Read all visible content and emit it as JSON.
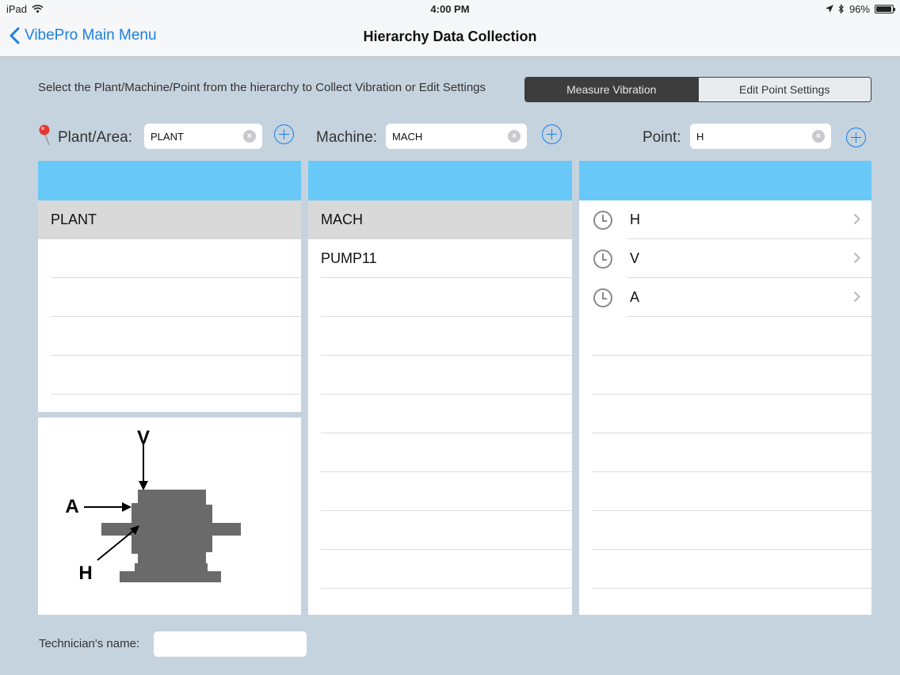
{
  "status": {
    "device": "iPad",
    "time": "4:00 PM",
    "battery": "96%",
    "battery_level": 0.96
  },
  "nav": {
    "back_label": "VibePro Main Menu",
    "title": "Hierarchy Data Collection"
  },
  "instruction": "Select the Plant/Machine/Point from the hierarchy to Collect Vibration or Edit Settings",
  "segments": {
    "measure": "Measure Vibration",
    "edit": "Edit Point Settings"
  },
  "plant": {
    "label": "Plant/Area:",
    "search_value": "PLANT",
    "items": [
      "PLANT"
    ]
  },
  "machine": {
    "label": "Machine:",
    "search_value": "MACH",
    "items": [
      "MACH",
      "PUMP11"
    ]
  },
  "point": {
    "label": "Point:",
    "search_value": "H",
    "items": [
      "H",
      "V",
      "A"
    ]
  },
  "diagram": {
    "v": "V",
    "a": "A",
    "h": "H"
  },
  "technician": {
    "label": "Technician's name:",
    "value": ""
  },
  "colors": {
    "accent": "#1a7fe0",
    "header": "#68c8f8",
    "background": "#c5d3df",
    "selected": "#d9d9d9"
  }
}
